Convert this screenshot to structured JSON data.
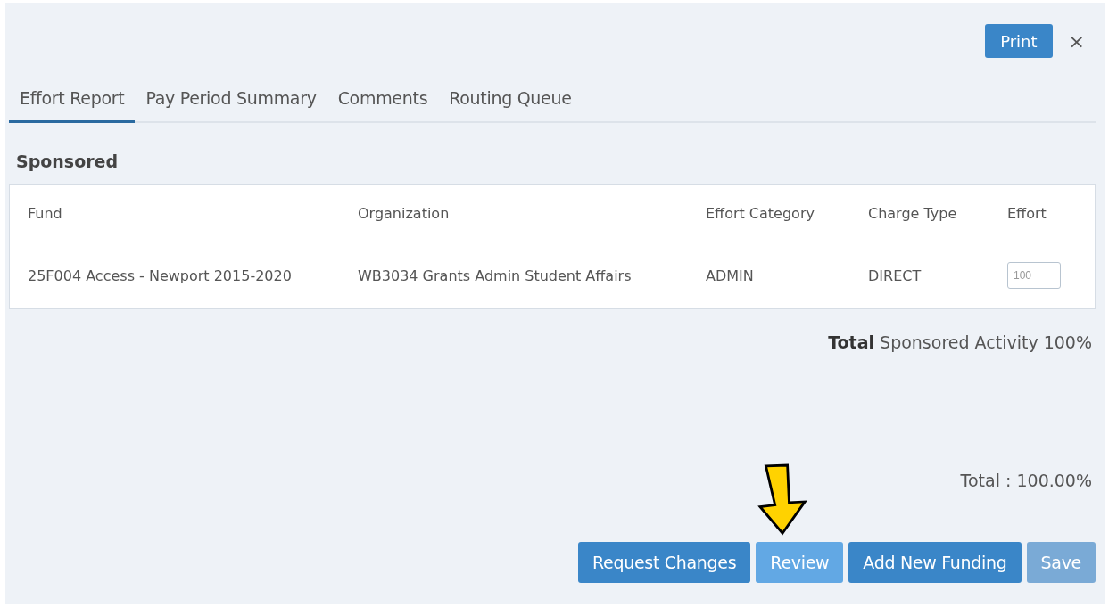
{
  "header": {
    "print_button": "Print",
    "close_button": "×"
  },
  "tabs": [
    {
      "label": "Effort Report",
      "selected": true
    },
    {
      "label": "Pay Period Summary",
      "selected": false
    },
    {
      "label": "Comments",
      "selected": false
    },
    {
      "label": "Routing Queue",
      "selected": false
    }
  ],
  "section_title": "Sponsored",
  "table": {
    "columns": [
      "Fund",
      "Organization",
      "Effort Category",
      "Charge Type",
      "Effort"
    ],
    "rows": [
      {
        "fund": "25F004 Access - Newport 2015-2020",
        "organization": "WB3034 Grants Admin Student Affairs",
        "effort_category": "ADMIN",
        "charge_type": "DIRECT",
        "effort": "100"
      }
    ]
  },
  "sponsored_total": "**Total** Sponsored Activity 100%",
  "grand_total": "Total : 100.00%",
  "buttons": [
    {
      "label": "Request Changes",
      "highlighted": false,
      "disabled": false
    },
    {
      "label": "Review",
      "highlighted": true,
      "disabled": false
    },
    {
      "label": "Add New Funding",
      "highlighted": false,
      "disabled": false
    },
    {
      "label": "Save",
      "highlighted": false,
      "disabled": true
    }
  ]
}
